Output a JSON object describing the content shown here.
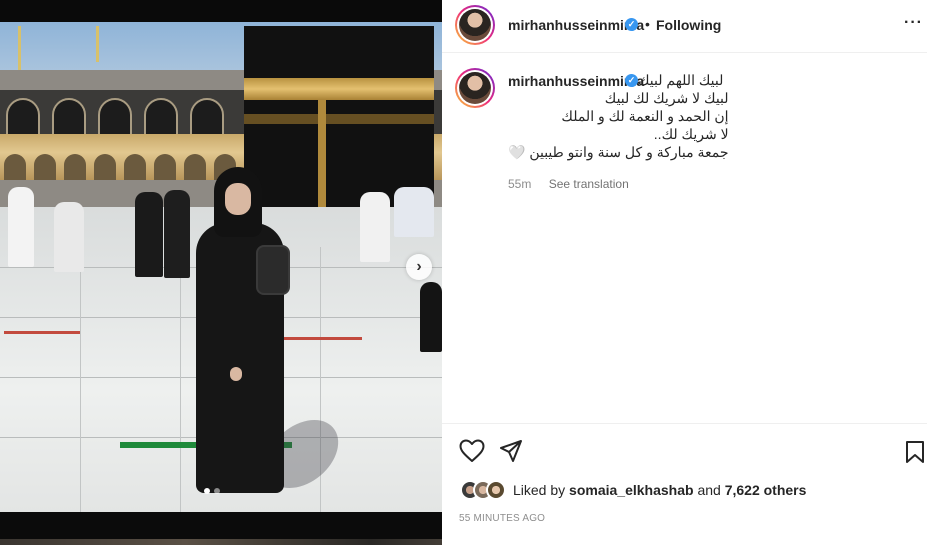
{
  "post": {
    "username": "mirhanhusseinmima",
    "follow_status": "Following",
    "caption_lines": [
      "لبيك اللهم لبيك",
      "لبيك لا شريك لك لبيك",
      "إن الحمد و النعمة لك و الملك",
      "لا شريك لك..",
      "جمعة مباركة و كل سنة وانتو طيبين 🤍"
    ],
    "caption_time": "55m",
    "see_translation": "See translation",
    "likes": {
      "prefix": "Liked by",
      "user": "somaia_elkhashab",
      "connector": "and",
      "count": "7,622 others"
    },
    "timestamp": "55 MINUTES AGO"
  },
  "icons": {
    "verified": "verified-badge-icon",
    "more": "more-options-icon",
    "like": "heart-icon",
    "share": "share-icon",
    "save": "bookmark-icon",
    "next": "chevron-right-icon"
  },
  "colors": {
    "accent": "#3897f0",
    "text": "#262626",
    "muted": "#8e8e8e"
  }
}
